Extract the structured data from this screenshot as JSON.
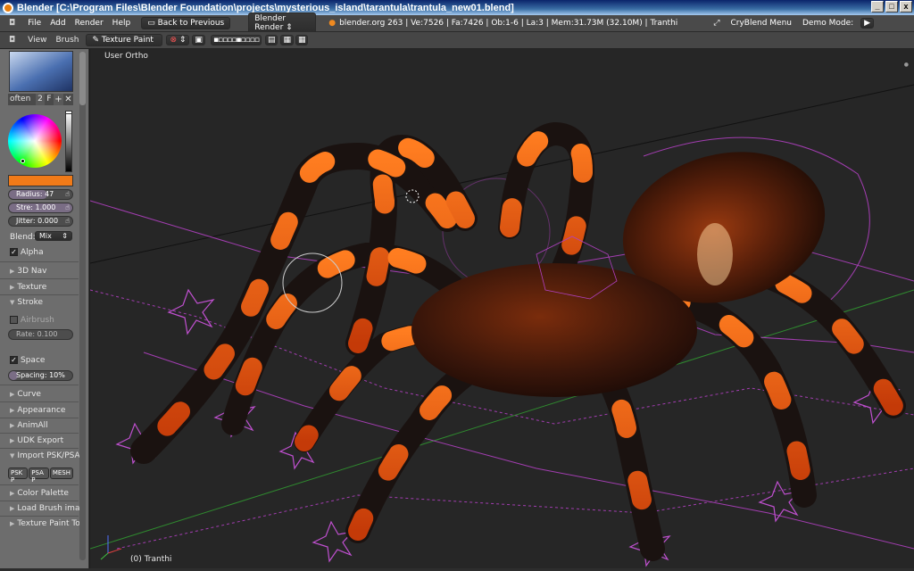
{
  "window": {
    "title": "Blender [C:\\Program Files\\Blender Foundation\\projects\\mysterious_island\\tarantula\\trantula_new01.blend]",
    "min": "_",
    "max": "□",
    "close": "x"
  },
  "infobar": {
    "menus": [
      "File",
      "Add",
      "Render",
      "Help"
    ],
    "back_button": "Back to Previous",
    "render_engine": "Blender Render",
    "stats": "blender.org 263 | Ve:7526 | Fa:7426 | Ob:1-6 | La:3 | Mem:31.73M (32.10M) | Tranthi",
    "cryblend": "CryBlend Menu",
    "demo_mode": "Demo Mode:"
  },
  "viewheader": {
    "menus": [
      "View",
      "Brush"
    ],
    "mode": "Texture Paint"
  },
  "toolshelf": {
    "brush_name": "often",
    "brush_users": "2",
    "brush_fake": "F",
    "brush_color": "#f07a18",
    "radius": "Radius: 47",
    "strength": "Stre: 1.000",
    "jitter": "Jitter: 0.000",
    "blend_label": "Blend:",
    "blend_value": "Mix",
    "alpha": "Alpha",
    "panels_a": [
      "3D Nav",
      "Texture"
    ],
    "stroke": "Stroke",
    "airbrush": "Airbrush",
    "rate": "Rate: 0.100",
    "space": "Space",
    "spacing": "Spacing: 10%",
    "panels_b": [
      "Curve",
      "Appearance",
      "AnimAll",
      "UDK Export"
    ],
    "import_panel": "Import PSK/PSA",
    "import_buttons": [
      "PSK P",
      "PSA P",
      "MESH"
    ],
    "panels_c": [
      "Color Palette",
      "Load Brush imag",
      "Texture Paint Tog"
    ]
  },
  "viewport": {
    "view_label": "User Ortho",
    "object_label": "(0) Tranthi"
  },
  "colors": {
    "wire": "#b040c0",
    "leg_orange": "#ff6a10",
    "grid_green": "#2f8a2f"
  }
}
